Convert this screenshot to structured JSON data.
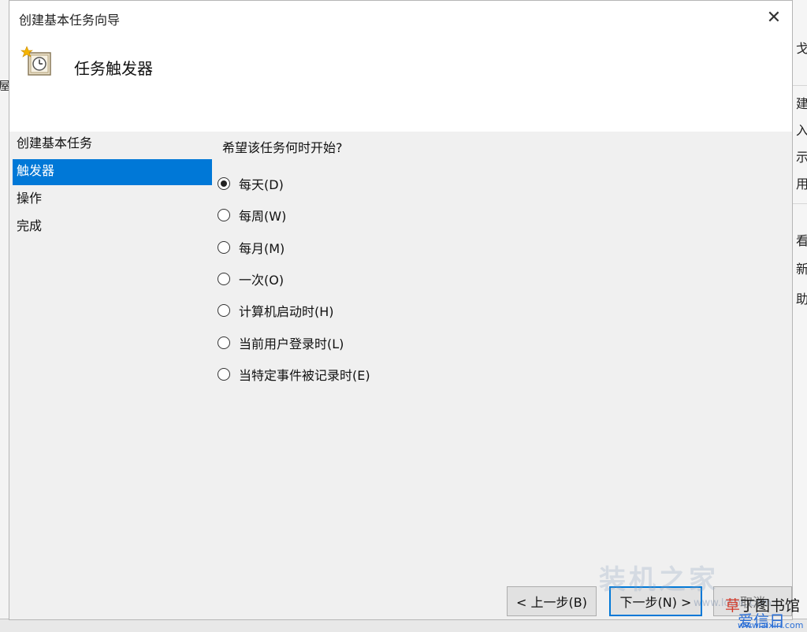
{
  "window": {
    "title": "创建基本任务向导",
    "close_label": "✕"
  },
  "header": {
    "title": "任务触发器",
    "icon": "task-clock-icon"
  },
  "nav": {
    "items": [
      {
        "label": "创建基本任务"
      },
      {
        "label": "触发器"
      },
      {
        "label": "操作"
      },
      {
        "label": "完成"
      }
    ],
    "active_index": 1
  },
  "content": {
    "question": "希望该任务何时开始?",
    "options": [
      {
        "label": "每天(D)",
        "selected": true
      },
      {
        "label": "每周(W)",
        "selected": false
      },
      {
        "label": "每月(M)",
        "selected": false
      },
      {
        "label": "一次(O)",
        "selected": false
      },
      {
        "label": "计算机启动时(H)",
        "selected": false
      },
      {
        "label": "当前用户登录时(L)",
        "selected": false
      },
      {
        "label": "当特定事件被记录时(E)",
        "selected": false
      }
    ]
  },
  "buttons": {
    "back": "< 上一步(B)",
    "next": "下一步(N) >",
    "cancel": "取消"
  },
  "background": {
    "left_char": "屋",
    "right_chars": [
      "戈",
      "建",
      "入",
      "示",
      "用",
      "看",
      "新",
      "助"
    ]
  },
  "watermarks": {
    "site1": "装机之家",
    "site1_url": "www.lotpc.com",
    "site2_a": "草",
    "site2_b": "丁图书馆",
    "site2_line2": "爱信日",
    "site2_url": "www.aixiri.com"
  },
  "colors": {
    "accent": "#0078d7",
    "selection_bg": "#0078d7",
    "dialog_bg": "#f0f0f0",
    "header_bg": "#ffffff"
  }
}
